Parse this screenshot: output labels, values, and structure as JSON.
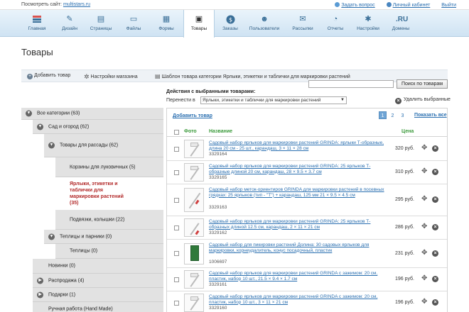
{
  "topbar": {
    "view_site_label": "Посмотреть сайт:",
    "site_link": "multistars.ru",
    "ask_question": "Задать вопрос",
    "personal_cabinet": "Личный кабинет",
    "logout": "Выйти"
  },
  "nav": {
    "items": [
      {
        "label": "Главная",
        "icon": "home-icon"
      },
      {
        "label": "Дизайн",
        "icon": "brush-icon"
      },
      {
        "label": "Страницы",
        "icon": "pages-icon"
      },
      {
        "label": "Файлы",
        "icon": "folder-icon"
      },
      {
        "label": "Формы",
        "icon": "forms-icon"
      },
      {
        "label": "Товары",
        "icon": "cash-register-icon",
        "active": true
      },
      {
        "label": "Заказы",
        "icon": "dollar-icon"
      },
      {
        "label": "Пользователи",
        "icon": "users-icon"
      },
      {
        "label": "Рассылки",
        "icon": "mail-icon"
      },
      {
        "label": "Отчеты",
        "icon": "chart-icon"
      },
      {
        "label": "Настройки",
        "icon": "gears-icon"
      },
      {
        "label": "Домены",
        "icon": "domain-icon",
        "glyph": ".RU"
      }
    ]
  },
  "page": {
    "title": "Товары"
  },
  "actions": {
    "add_product": "Добавить товар",
    "shop_settings": "Настройки магазина",
    "category_template": "Шаблон товара категории Ярлыки, этикетки и таблички для маркировки растений"
  },
  "search": {
    "value": "",
    "button": "Поиск по товарам"
  },
  "bulk": {
    "title": "Действия с выбранными товарами:",
    "move_label": "Перенести в",
    "move_target": "Ярлыки, этикетки и таблички для маркировки растений",
    "delete_selected": "Удалить выбранные"
  },
  "categories": [
    {
      "label": "Все категории (63)",
      "toggle": "expanded"
    },
    {
      "label": "Сад и огород (62)",
      "toggle": "expanded"
    },
    {
      "label": "Товары для рассады (62)",
      "toggle": "expanded"
    },
    {
      "label": "Корзины для луковичных (5)",
      "toggle": "none"
    },
    {
      "label": "Ярлыки, этикетки и таблички для маркировки растений (35)",
      "toggle": "none",
      "selected": true
    },
    {
      "label": "Подвязки, колышки (22)",
      "toggle": "none"
    },
    {
      "label": "Теплицы и парники (0)",
      "toggle": "expanded"
    },
    {
      "label": "Теплицы (0)",
      "toggle": "none"
    },
    {
      "label": "Новинки (0)",
      "toggle": "none"
    },
    {
      "label": "Распродажа (4)",
      "toggle": "collapsed"
    },
    {
      "label": "Подарки (1)",
      "toggle": "collapsed"
    },
    {
      "label": "Ручная работа (Hand Made)",
      "toggle": "none"
    }
  ],
  "products_panel": {
    "add_link": "Добавить товар",
    "pages": [
      "1",
      "2",
      "3"
    ],
    "current_page": "1",
    "show_all": "Показать все",
    "columns": {
      "photo": "Фото",
      "name": "Название",
      "price": "Цена"
    }
  },
  "products": [
    {
      "name": "Садовый набор ярлыков для маркировки растений GRINDA: ярлыки Т-образные, длина 20 см - 25 шт., карандаш, 3 × 11 × 28 см",
      "code": "3329164",
      "price": "320 руб."
    },
    {
      "name": "Садовый набор ярлыков для маркировки растений GRINDA: 25 ярлыков Т-образные длиной 20 см, карандаш, 28 × 9.5 × 3.7 см",
      "code": "3329165",
      "price": "310 руб."
    },
    {
      "name": "Садовый набор меток-ориентиров GRINDA для маркировки растений в посевных грядках: 25 ярлыков (тип - \"Т\") + карандаш, 125 мм 21 × 9.5 × 4.5 см",
      "code": "3329163",
      "price": "295 руб."
    },
    {
      "name": "Садовый набор ярлыков для маркировки растений GRINDA: 25 ярлыков Т-образных длиной 12.5 см, карандаш, 2 × 11 × 21 см",
      "code": "3329162",
      "price": "286 руб."
    },
    {
      "name": "Садовый набор для пикировки растений Долина: 30 садовых ярлыков для маркировки, корнеудалитель, конус посадочный, пластик",
      "code": "1006697",
      "price": "231 руб."
    },
    {
      "name": "Садовый набор ярлыков для маркировки растений GRINDA с зажимом: 20 см, пластик, набор 10 шт., 21.5 × 9.4 × 1.7 см",
      "code": "3329161",
      "price": "196 руб."
    },
    {
      "name": "Садовый набор ярлыков для маркировки растений GRINDA с зажимом: 20 см, пластик, набор 10 шт., 3 × 11 × 21 см",
      "code": "3329160",
      "price": "196 руб."
    }
  ],
  "colors": {
    "nav_bg": "#cfe3f3",
    "selected_category": "#b32b2b",
    "column_header": "#3b9a3b",
    "link": "#2a6fb0"
  }
}
